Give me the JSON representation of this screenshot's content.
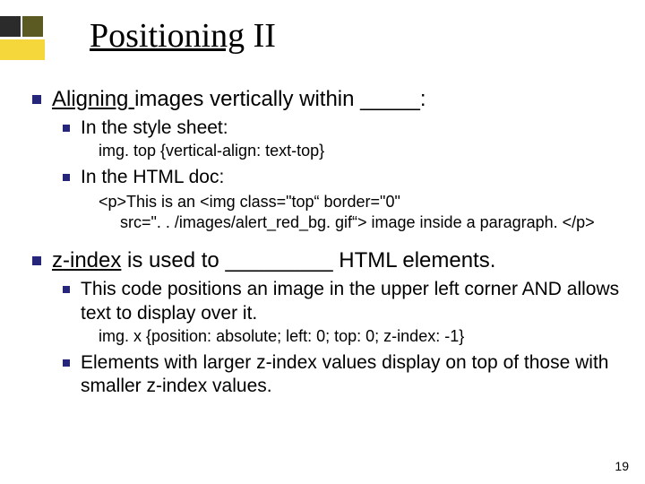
{
  "title": {
    "underlined": "Positioning",
    "rest": " II"
  },
  "b1": {
    "underlined": "Aligning ",
    "rest": "images vertically within _____:",
    "sub1": "In the style sheet:",
    "code1": "img. top {vertical-align: text-top}",
    "sub2": "In the HTML doc:",
    "code2_l1": "<p>This is an <img class=\"top“ border=\"0\"",
    "code2_l2": "src=\". . /images/alert_red_bg. gif“> image inside a paragraph. </p>"
  },
  "b2": {
    "underlined": "z-index",
    "rest": " is used to _________ HTML elements.",
    "sub1": "This code positions an image in the upper left corner AND allows text to display over it.",
    "code1": "img. x {position: absolute; left: 0; top: 0; z-index: -1}",
    "sub2": "Elements with larger z-index values display on top of those with smaller z-index values."
  },
  "page_number": "19"
}
